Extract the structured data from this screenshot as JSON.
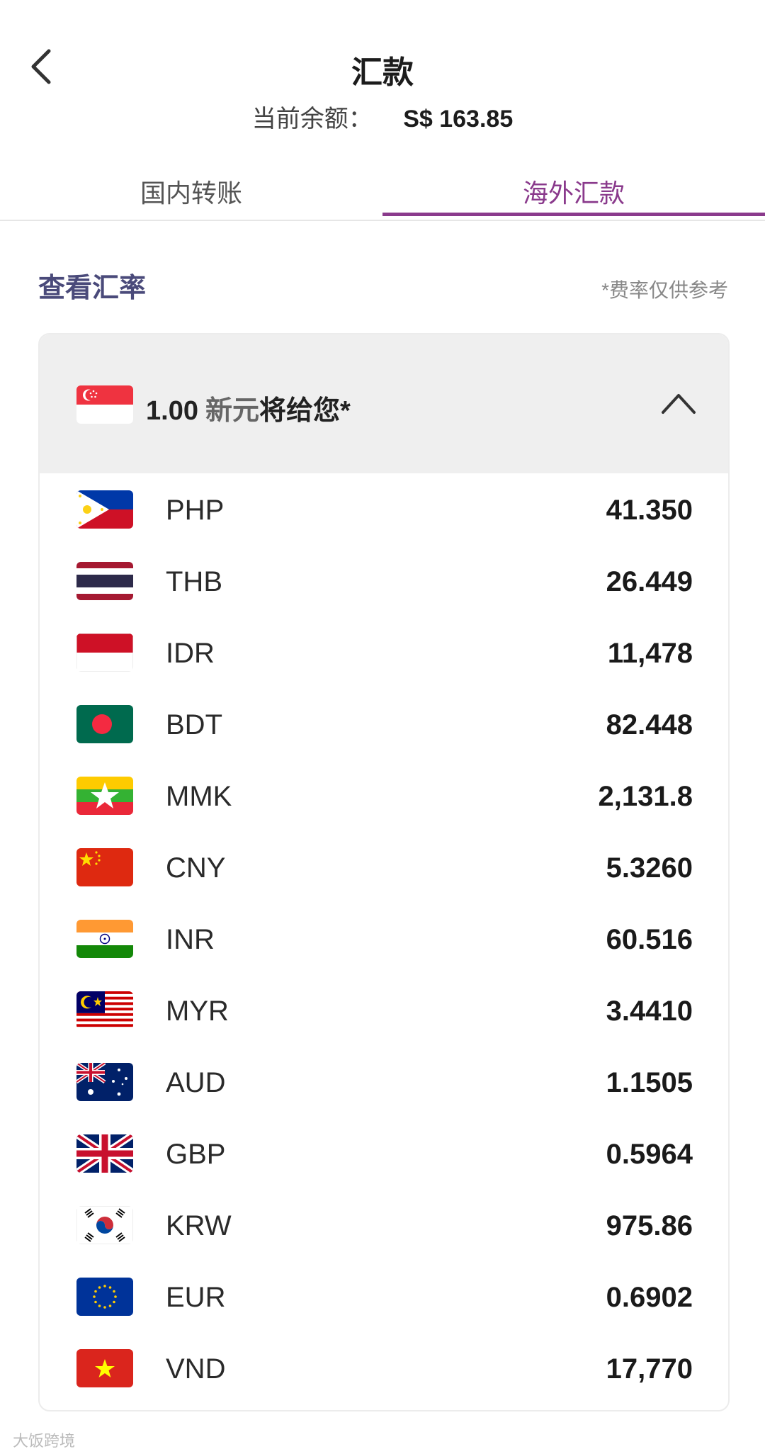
{
  "header": {
    "title": "汇款",
    "balance_label": "当前余额：",
    "balance_value": "S$ 163.85"
  },
  "tabs": [
    {
      "label": "国内转账",
      "active": false
    },
    {
      "label": "海外汇款",
      "active": true
    }
  ],
  "section": {
    "title": "查看汇率",
    "note": "*费率仅供参考"
  },
  "rate_card": {
    "base_amount": "1.00",
    "base_currency": "新元",
    "base_suffix": "将给您*",
    "base_flag_icon": "singapore-flag-icon",
    "collapse_icon": "chevron-up-icon",
    "rates": [
      {
        "code": "PHP",
        "value": "41.350",
        "flag": "philippines-flag-icon"
      },
      {
        "code": "THB",
        "value": "26.449",
        "flag": "thailand-flag-icon"
      },
      {
        "code": "IDR",
        "value": "11,478",
        "flag": "indonesia-flag-icon"
      },
      {
        "code": "BDT",
        "value": "82.448",
        "flag": "bangladesh-flag-icon"
      },
      {
        "code": "MMK",
        "value": "2,131.8",
        "flag": "myanmar-flag-icon"
      },
      {
        "code": "CNY",
        "value": "5.3260",
        "flag": "china-flag-icon"
      },
      {
        "code": "INR",
        "value": "60.516",
        "flag": "india-flag-icon"
      },
      {
        "code": "MYR",
        "value": "3.4410",
        "flag": "malaysia-flag-icon"
      },
      {
        "code": "AUD",
        "value": "1.1505",
        "flag": "australia-flag-icon"
      },
      {
        "code": "GBP",
        "value": "0.5964",
        "flag": "uk-flag-icon"
      },
      {
        "code": "KRW",
        "value": "975.86",
        "flag": "korea-flag-icon"
      },
      {
        "code": "EUR",
        "value": "0.6902",
        "flag": "eu-flag-icon"
      },
      {
        "code": "VND",
        "value": "17,770",
        "flag": "vietnam-flag-icon"
      }
    ]
  },
  "colors": {
    "accent": "#8a3a8c",
    "section_title": "#4a4a7a",
    "card_header_bg": "#efefef"
  },
  "watermark": "大饭跨境"
}
